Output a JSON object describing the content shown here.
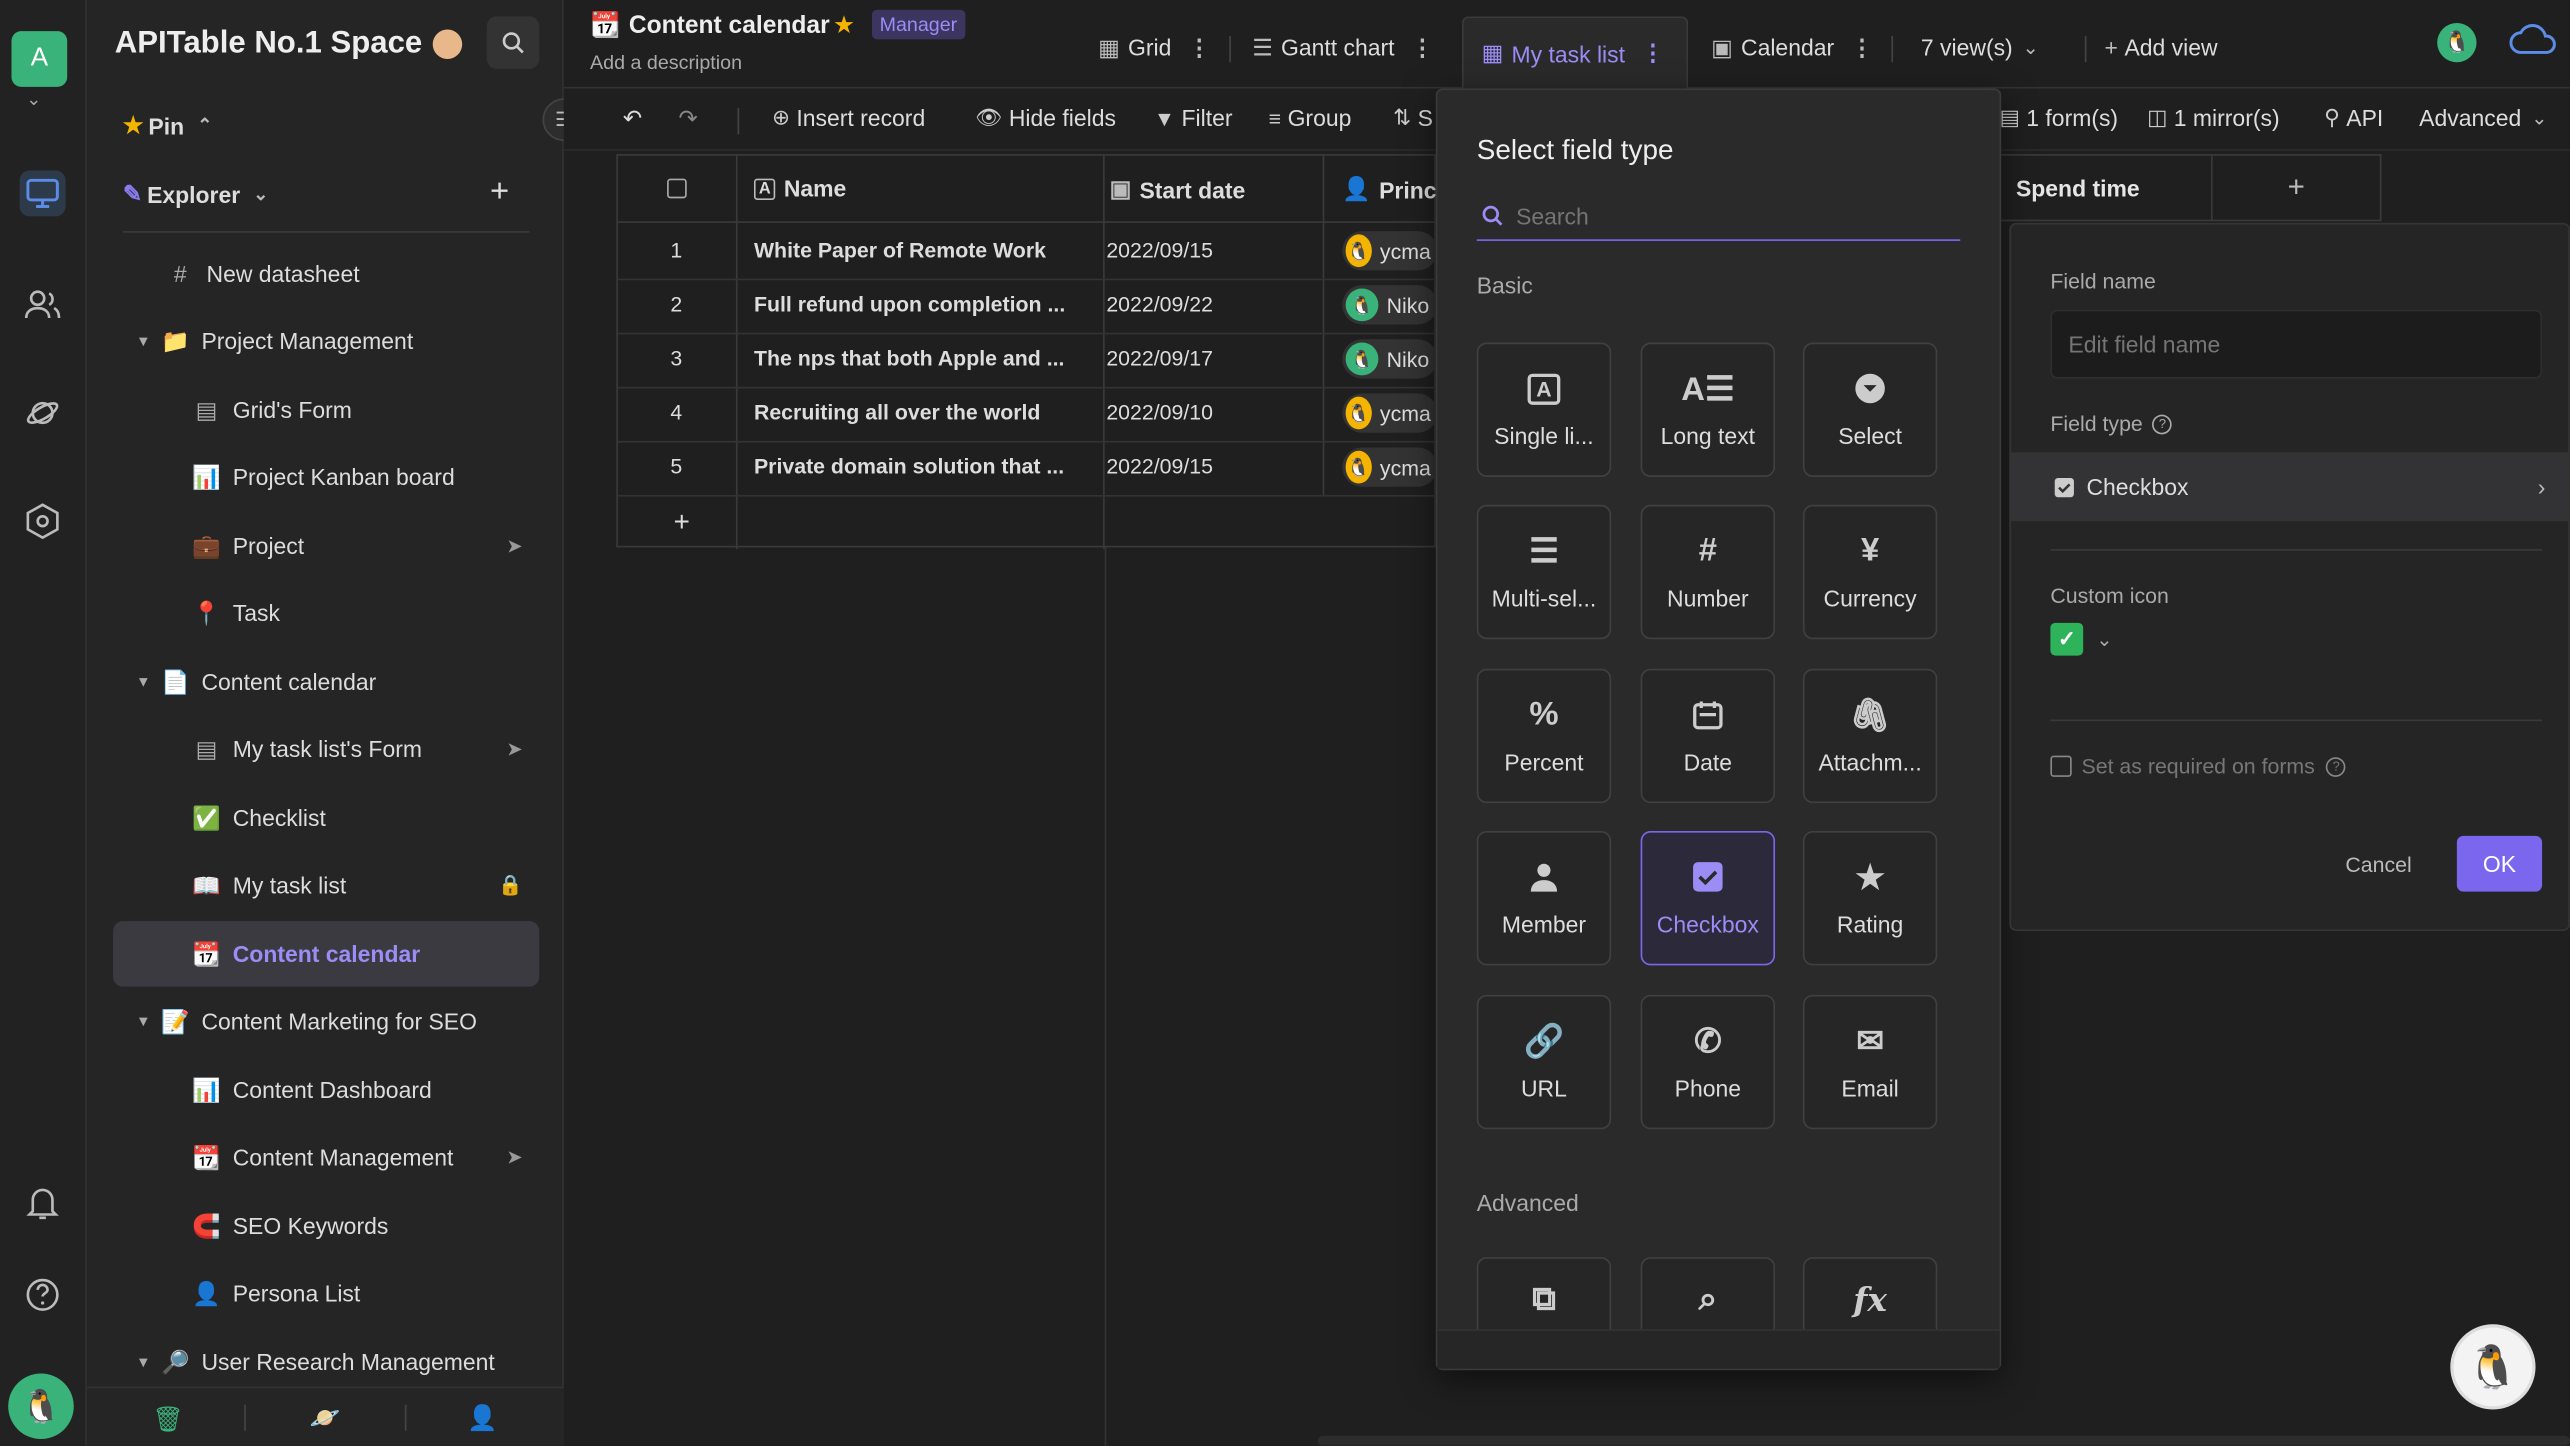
{
  "rail": {
    "avatar_letter": "A"
  },
  "sidebar": {
    "space_title": "APITable No.1 Space",
    "pin_label": "Pin",
    "explorer_label": "Explorer",
    "items": [
      {
        "label": "New datasheet",
        "emoji": "#"
      },
      {
        "label": "Project Management",
        "emoji": "📁"
      },
      {
        "label": "Grid's Form",
        "emoji": "▤"
      },
      {
        "label": "Project Kanban board",
        "emoji": "📊"
      },
      {
        "label": "Project",
        "emoji": "💼"
      },
      {
        "label": "Task",
        "emoji": "📍"
      },
      {
        "label": "Content calendar",
        "emoji": "📄"
      },
      {
        "label": "My task list's Form",
        "emoji": "▤"
      },
      {
        "label": "Checklist",
        "emoji": "✅"
      },
      {
        "label": "My task list",
        "emoji": "📖"
      },
      {
        "label": "Content calendar",
        "emoji": "📆"
      },
      {
        "label": "Content Marketing for SEO",
        "emoji": "📝"
      },
      {
        "label": "Content Dashboard",
        "emoji": "📊"
      },
      {
        "label": "Content Management",
        "emoji": "📆"
      },
      {
        "label": "SEO Keywords",
        "emoji": "🧲"
      },
      {
        "label": "Persona List",
        "emoji": "👤"
      },
      {
        "label": "User Research Management",
        "emoji": "🔎"
      }
    ]
  },
  "header": {
    "title": "Content calendar",
    "role_badge": "Manager",
    "description": "Add a description",
    "tabs": [
      "Grid",
      "Gantt chart",
      "My task list",
      "Calendar"
    ],
    "views_count": "7 view(s)",
    "add_view": "Add view"
  },
  "toolbar": {
    "insert_record": "Insert record",
    "hide_fields": "Hide fields",
    "filter": "Filter",
    "group": "Group",
    "sort_partial": "S",
    "forms": "1 form(s)",
    "mirrors": "1 mirror(s)",
    "api": "API",
    "advanced": "Advanced"
  },
  "grid": {
    "columns": [
      "Name",
      "Start date",
      "Princi"
    ],
    "spend_time_col": "Spend time",
    "rows": [
      {
        "num": "1",
        "name": "White Paper of Remote Work",
        "date": "2022/09/15",
        "person": "ycma"
      },
      {
        "num": "2",
        "name": "Full refund upon completion ...",
        "date": "2022/09/22",
        "person": "Niko"
      },
      {
        "num": "3",
        "name": "The nps that both Apple and ...",
        "date": "2022/09/17",
        "person": "Niko"
      },
      {
        "num": "4",
        "name": "Recruiting all over the world",
        "date": "2022/09/10",
        "person": "ycma"
      },
      {
        "num": "5",
        "name": "Private domain solution that ...",
        "date": "2022/09/15",
        "person": "ycma"
      }
    ],
    "add_row": "+"
  },
  "picker": {
    "title": "Select field type",
    "search_placeholder": "Search",
    "basic_label": "Basic",
    "advanced_label": "Advanced",
    "types": [
      "Single li...",
      "Long text",
      "Select",
      "Multi-sel...",
      "Number",
      "Currency",
      "Percent",
      "Date",
      "Attachm...",
      "Member",
      "Checkbox",
      "Rating",
      "URL",
      "Phone",
      "Email"
    ],
    "selected": "Checkbox"
  },
  "edit": {
    "field_name_label": "Field name",
    "field_name_placeholder": "Edit field name",
    "field_type_label": "Field type",
    "field_type_value": "Checkbox",
    "custom_icon_label": "Custom icon",
    "required_label": "Set as required on forms",
    "cancel": "Cancel",
    "ok": "OK"
  },
  "colors": {
    "accent": "#7b67ee",
    "bg": "#1f1f1f",
    "sidebar": "#252526",
    "active_item": "#3a3a40"
  }
}
